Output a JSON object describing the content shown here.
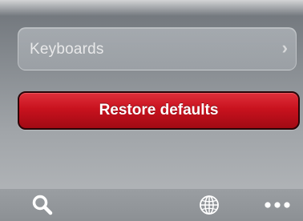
{
  "settings": {
    "keyboards_label": "Keyboards",
    "restore_label": "Restore defaults"
  },
  "toolbar": {
    "icons": [
      "search-icon",
      "globe-icon",
      "more-icon"
    ]
  },
  "colors": {
    "restore_button": "#c8121e",
    "background": "#8e9296"
  }
}
